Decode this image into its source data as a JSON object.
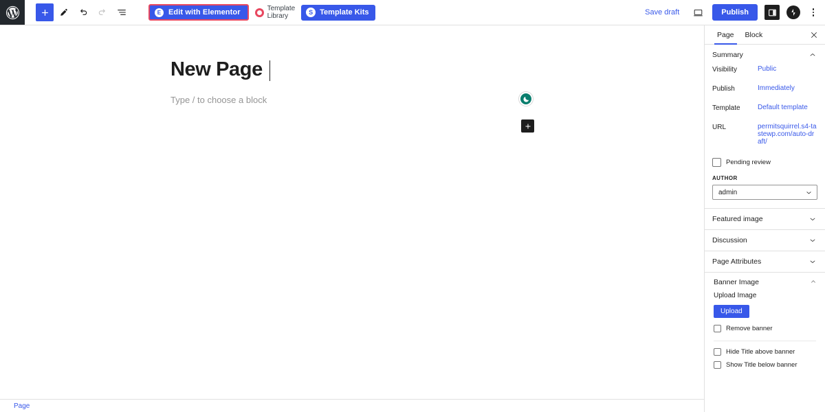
{
  "topbar": {
    "wp_logo": "wordpress-logo",
    "tools": [
      {
        "name": "add-block-button",
        "icon": "plus-icon",
        "label": "Add block"
      },
      {
        "name": "tools-button",
        "icon": "pencil-icon",
        "label": "Tools"
      },
      {
        "name": "undo-button",
        "icon": "undo-icon",
        "label": "Undo"
      },
      {
        "name": "redo-button",
        "icon": "redo-icon",
        "label": "Redo"
      },
      {
        "name": "list-view-button",
        "icon": "list-view-icon",
        "label": "Document Overview"
      }
    ],
    "elementor_button": "Edit with Elementor",
    "elementor_badge": "E",
    "template_library_line1": "Template",
    "template_library_line2": "Library",
    "template_kits_button": "Template Kits",
    "template_kits_badge": "S",
    "save_draft": "Save draft",
    "publish_button": "Publish",
    "preview_icon": "preview-desktop-icon",
    "sidebar_toggle_icon": "settings-sidebar-icon",
    "jetpack_icon": "jetpack-icon",
    "options_icon": "kebab-menu-icon"
  },
  "canvas": {
    "title": "New Page",
    "block_placeholder": "Type / to choose a block",
    "moon_badge_icon": "crescent-moon-icon",
    "inserter_icon": "plus-icon"
  },
  "bottombar": {
    "breadcrumb": "Page"
  },
  "support": {
    "icon": "chat-support-icon"
  },
  "sidebar": {
    "tabs": [
      {
        "label": "Page",
        "active": true
      },
      {
        "label": "Block",
        "active": false
      }
    ],
    "close_icon": "close-icon",
    "summary": {
      "title": "Summary",
      "chevron": "chevron-up-icon",
      "rows": [
        {
          "label": "Visibility",
          "value": "Public"
        },
        {
          "label": "Publish",
          "value": "Immediately"
        },
        {
          "label": "Template",
          "value": "Default template"
        },
        {
          "label": "URL",
          "value": "permitsquirrel.s4-tastewp.com/auto-draft/"
        }
      ],
      "pending_review": "Pending review",
      "author_label": "AUTHOR",
      "author_value": "admin"
    },
    "panels": [
      {
        "title": "Featured image",
        "chevron": "chevron-down-icon"
      },
      {
        "title": "Discussion",
        "chevron": "chevron-down-icon"
      },
      {
        "title": "Page Attributes",
        "chevron": "chevron-down-icon"
      }
    ],
    "banner": {
      "title": "Banner Image",
      "chevron": "chevron-up-icon",
      "upload_label": "Upload Image",
      "upload_button": "Upload",
      "remove_banner": "Remove banner",
      "hide_title_above": "Hide Title above banner",
      "show_title_below": "Show Title below banner"
    }
  },
  "colors": {
    "accent": "#3858e9",
    "elementor_outline": "#e8475f",
    "moon_badge": "#0a7e6e",
    "support_green": "#4caf50",
    "dark": "#1e1e1e"
  }
}
